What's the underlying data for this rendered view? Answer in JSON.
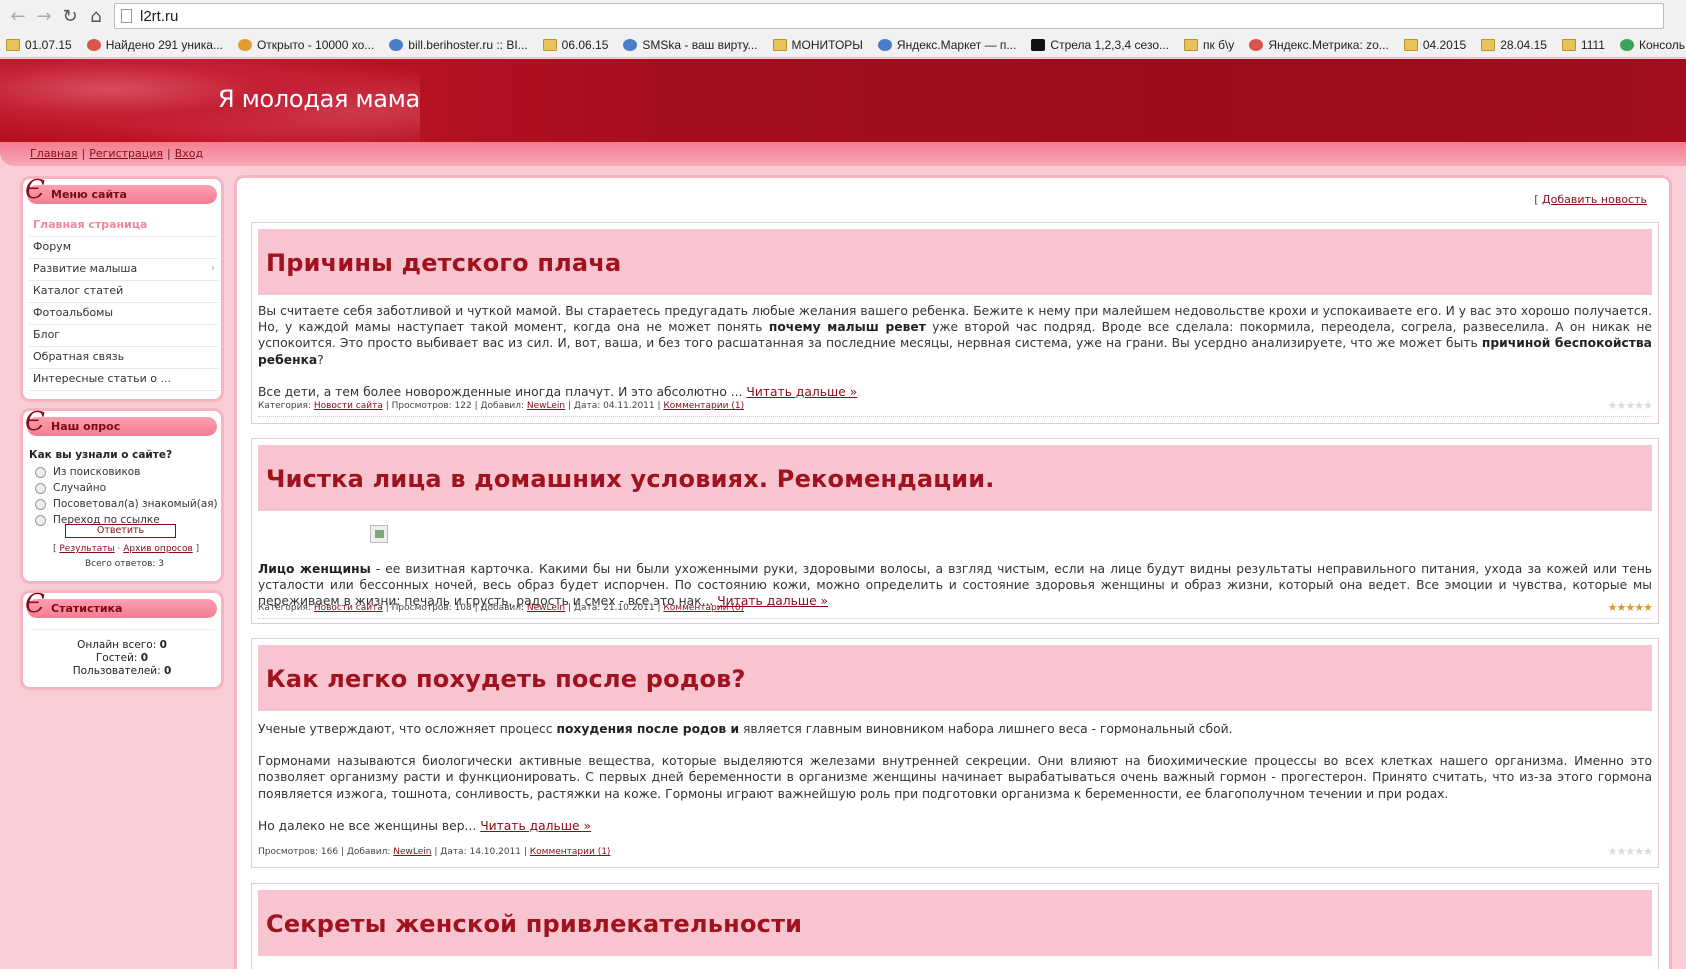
{
  "browser": {
    "url": "l2rt.ru",
    "bookmarks": [
      {
        "label": "01.07.15",
        "icon": "folder-icon"
      },
      {
        "label": "Найдено 291 уника...",
        "icon": "favicon"
      },
      {
        "label": "Открыто - 10000 хо...",
        "icon": "favicon"
      },
      {
        "label": "bill.berihoster.ru :: BI...",
        "icon": "favicon"
      },
      {
        "label": "06.06.15",
        "icon": "folder-icon"
      },
      {
        "label": "SMSka - ваш вирту...",
        "icon": "favicon"
      },
      {
        "label": "МОНИТОРЫ",
        "icon": "folder-icon"
      },
      {
        "label": "Яндекс.Маркет — п...",
        "icon": "favicon"
      },
      {
        "label": "Стрела 1,2,3,4 сезо...",
        "icon": "favicon"
      },
      {
        "label": "пк б\\у",
        "icon": "folder-icon"
      },
      {
        "label": "Яндекс.Метрика: zo...",
        "icon": "favicon"
      },
      {
        "label": "04.2015",
        "icon": "folder-icon"
      },
      {
        "label": "28.04.15",
        "icon": "folder-icon"
      },
      {
        "label": "1111",
        "icon": "folder-icon"
      },
      {
        "label": "Консоль › Лу",
        "icon": "favicon"
      }
    ]
  },
  "site": {
    "title": "Я молодая мама",
    "top_links": [
      "Главная",
      "Регистрация",
      "Вход"
    ]
  },
  "sidebar": {
    "menu": {
      "title": "Меню сайта",
      "items": [
        {
          "label": "Главная страница",
          "current": true
        },
        {
          "label": "Форум"
        },
        {
          "label": "Развитие малыша",
          "submenu": true
        },
        {
          "label": "Каталог статей"
        },
        {
          "label": "Фотоальбомы"
        },
        {
          "label": "Блог"
        },
        {
          "label": "Обратная связь"
        },
        {
          "label": "Интересные статьи о ..."
        }
      ]
    },
    "poll": {
      "title": "Наш опрос",
      "question": "Как вы узнали о сайте?",
      "options": [
        "Из поисковиков",
        "Случайно",
        "Посоветовал(а) знакомый(ая)",
        "Переход по ссылке"
      ],
      "answer_button": "Ответить",
      "results_link": "Результаты",
      "archive_link": "Архив опросов",
      "total": "Всего ответов: 3"
    },
    "stats": {
      "title": "Статистика",
      "online_label": "Онлайн всего:",
      "online_value": "0",
      "guests_label": "Гостей:",
      "guests_value": "0",
      "users_label": "Пользователей:",
      "users_value": "0"
    }
  },
  "main": {
    "add_news": "Добавить новость",
    "articles": [
      {
        "title": "Причины детского плача",
        "para1_a": "Вы считаете себя заботливой и чуткой мамой. Вы стараетесь предугадать любые желания вашего ребенка. Бежите к нему при малейшем недовольстве крохи и успокаиваете его. И у вас это хорошо получается. Но, у каждой мамы наступает такой момент, когда она не может понять ",
        "para1_b": "почему малыш ревет",
        "para1_c": " уже второй час подряд. Вроде все сделала: покормила, переодела, согрела, развеселила. А он никак не успокоится. Это просто выбивает вас из сил. И, вот, ваша, и без того расшатанная за последние месяцы, нервная система, уже на грани. Вы усердно анализируете, что же может быть ",
        "para1_d": "причиной беспокойства ребенка",
        "para1_e": "?",
        "para2": "Все дети, а тем более новорожденные иногда плачут. И это абсолютно ...",
        "read_more": "Читать дальше »",
        "category_label": "Категория:",
        "category": "Новости сайта",
        "views": "Просмотров: 122",
        "added_label": "Добавил:",
        "author": "NewLein",
        "date": "Дата: 04.11.2011",
        "comments": "Комментарии (1)",
        "rating": 0
      },
      {
        "title": "Чистка лица в домашних условиях. Рекомендации.",
        "para1_b": "Лицо женщины",
        "para1_c": " - ее визитная карточка. Какими бы ни были ухоженными руки, здоровыми волосы, а взгляд чистым, если на лице будут видны результаты неправильного питания, ухода за кожей или тень усталости или бессонных ночей, весь образ будет испорчен. По состоянию кожи, можно определить и состояние здоровья женщины и образ жизни, который она ведет. Все эмоции и чувства, которые мы переживаем в жизни: печаль и грусть, радость и смех - все это нак...",
        "read_more": "Читать дальше »",
        "category_label": "Категория:",
        "category": "Новости сайта",
        "views": "Просмотров: 108",
        "added_label": "Добавил:",
        "author": "NewLein",
        "date": "Дата: 21.10.2011",
        "comments": "Комментарии (0)",
        "rating": 5
      },
      {
        "title": "Как легко похудеть после родов?",
        "para1_a": "Ученые утверждают, что осложняет процесс ",
        "para1_b": "похудения после родов и",
        "para1_c": " является главным виновником набора лишнего веса - гормональный сбой.",
        "para2": "Гормонами называются биологически активные вещества, которые выделяются железами внутренней секреции. Они влияют на биохимические процессы во всех клетках нашего организма. Именно это позволяет организму расти и функционировать. С первых дней беременности в организме женщины начинает вырабатываться очень важный гормон - прогестерон. Принято считать, что из-за этого гормона появляется изжога, тошнота, сонливость, растяжки на коже. Гормоны играют важнейшую роль при подготовки организма к беременности, ее благополучном течении и при родах.",
        "para3": "Но далеко не все женщины вер...",
        "read_more": "Читать дальше »",
        "views": "Просмотров: 166",
        "added_label": "Добавил:",
        "author": "NewLein",
        "date": "Дата: 14.10.2011",
        "comments": "Комментарии (1)",
        "rating": 0
      },
      {
        "title": "Секреты женской привлекательности"
      }
    ]
  }
}
